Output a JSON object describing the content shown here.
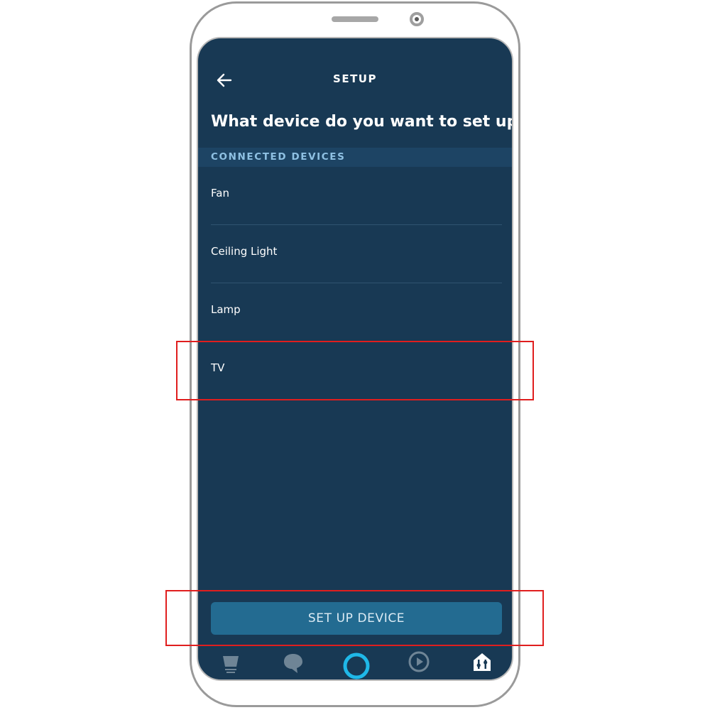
{
  "header": {
    "title": "SETUP"
  },
  "question": "What device do you want to set up?",
  "section": {
    "label": "CONNECTED DEVICES"
  },
  "devices": [
    {
      "label": "Fan"
    },
    {
      "label": "Ceiling Light"
    },
    {
      "label": "Lamp"
    },
    {
      "label": "TV"
    }
  ],
  "setup_button": {
    "label": "SET UP DEVICE"
  },
  "tabs": [
    {
      "icon": "home-icon"
    },
    {
      "icon": "communicate-icon"
    },
    {
      "icon": "alexa-icon"
    },
    {
      "icon": "play-icon"
    },
    {
      "icon": "devices-icon"
    }
  ],
  "colors": {
    "screen_bg": "#183954",
    "section_bg": "#1d4464",
    "section_text": "#8fc1e3",
    "button_bg": "#236b91",
    "alexa_ring": "#1fb8e8",
    "highlight": "#e01e1e"
  }
}
